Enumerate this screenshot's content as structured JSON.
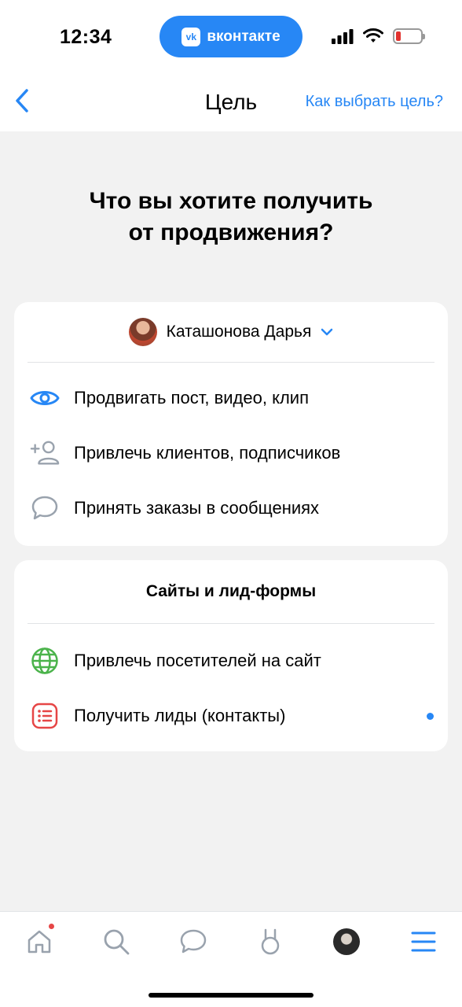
{
  "status_bar": {
    "time": "12:34",
    "app_pill": "вконтакте",
    "vk_logo": "vk"
  },
  "nav": {
    "title": "Цель",
    "help_link": "Как выбрать цель?"
  },
  "headline": {
    "line1": "Что вы хотите получить",
    "line2": "от продвижения?"
  },
  "card1": {
    "account_name": "Каташонова Дарья",
    "items": [
      {
        "label": "Продвигать пост, видео, клип",
        "icon": "eye-icon"
      },
      {
        "label": "Привлечь клиентов, подписчиков",
        "icon": "add-user-icon"
      },
      {
        "label": "Принять заказы в сообщениях",
        "icon": "message-icon"
      }
    ]
  },
  "card2": {
    "title": "Сайты и лид-формы",
    "items": [
      {
        "label": "Привлечь посетителей на сайт",
        "icon": "globe-icon"
      },
      {
        "label": "Получить лиды (контакты)",
        "icon": "list-icon"
      }
    ]
  },
  "colors": {
    "accent": "#2787f5",
    "eye": "#2787f5",
    "muted_icon": "#99a2ad",
    "globe": "#4bb34b",
    "list": "#e64646",
    "badge_red": "#e64646"
  },
  "tab_bar": [
    "home-icon",
    "search-icon",
    "messages-icon",
    "clips-icon",
    "profile-avatar",
    "menu-icon"
  ]
}
